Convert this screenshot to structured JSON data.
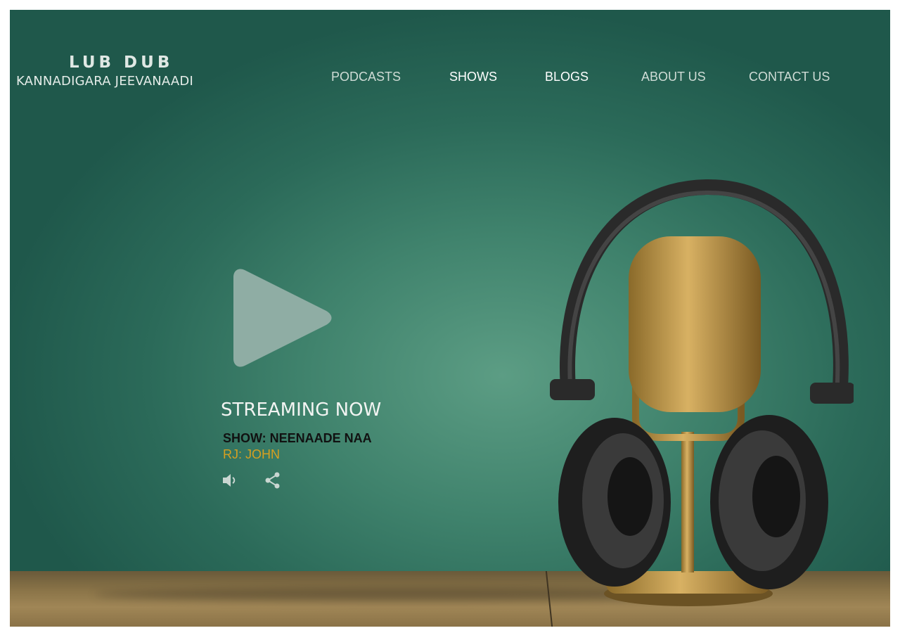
{
  "brand": {
    "title": "LUB DUB",
    "subtitle": "KANNADIGARA JEEVANAADI"
  },
  "nav": [
    {
      "label": "PODCASTS"
    },
    {
      "label": "SHOWS"
    },
    {
      "label": "BLOGS"
    },
    {
      "label": "ABOUT US"
    },
    {
      "label": "CONTACT US"
    }
  ],
  "hero": {
    "streaming_label": "STREAMING NOW",
    "show": "SHOW: NEENAADE NAA",
    "rj": "RJ: JOHN",
    "icons": [
      "play-icon",
      "volume-icon",
      "share-icon"
    ],
    "background_image": "headphones-microphone-photo"
  },
  "colors": {
    "background": "#3f826c",
    "nav_text": "#cfdcd6",
    "rj_text": "#d6a021",
    "show_text": "#111111"
  }
}
